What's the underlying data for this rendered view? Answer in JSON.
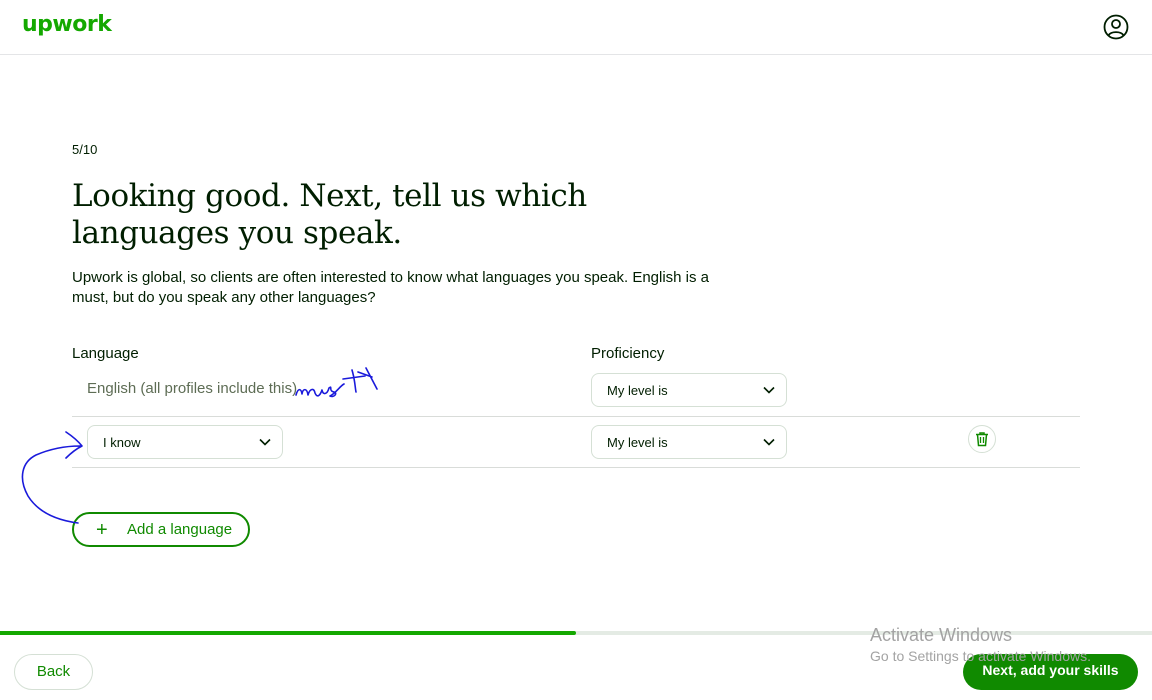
{
  "header": {
    "logo_text": "upwork",
    "account_icon": "user-circle-icon",
    "brand_color": "#14a800"
  },
  "step": {
    "label": "5/10",
    "progress_fraction": 0.5
  },
  "page": {
    "title": "Looking good. Next, tell us which languages you speak.",
    "subtitle": "Upwork is global, so clients are often interested to know what languages you speak. English is a must, but do you speak any other languages?"
  },
  "table": {
    "language_header": "Language",
    "proficiency_header": "Proficiency",
    "rows": [
      {
        "language": "English (all profiles include this)",
        "proficiency": "My level is"
      },
      {
        "language": "I know",
        "proficiency": "My level is",
        "delete_icon": "trash-icon"
      }
    ]
  },
  "add_language": {
    "label": "Add a language",
    "icon": "plus-icon"
  },
  "annotation": {
    "handwritten_text": "must",
    "color": "#1a1adb"
  },
  "footer": {
    "back_label": "Back",
    "next_label": "Next, add your skills"
  },
  "watermark": {
    "line1": "Activate Windows",
    "line2": "Go to Settings to activate Windows."
  }
}
